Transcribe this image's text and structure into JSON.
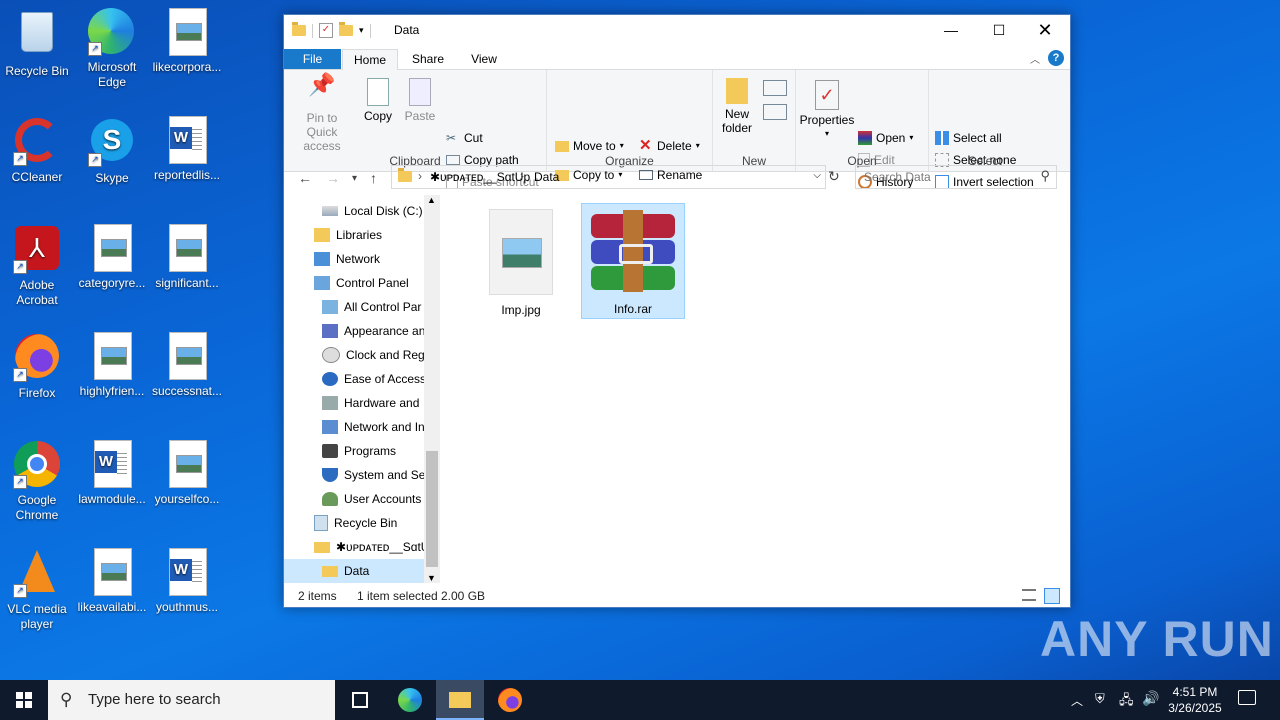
{
  "desktop": {
    "icons": [
      {
        "label": "Recycle Bin"
      },
      {
        "label": "Microsoft Edge"
      },
      {
        "label": "likecorpora..."
      },
      {
        "label": "CCleaner"
      },
      {
        "label": "Skype"
      },
      {
        "label": "reportedlis..."
      },
      {
        "label": "Adobe Acrobat"
      },
      {
        "label": "categoryre..."
      },
      {
        "label": "significant..."
      },
      {
        "label": "Firefox"
      },
      {
        "label": "highlyfrien..."
      },
      {
        "label": "successnat..."
      },
      {
        "label": "Google Chrome"
      },
      {
        "label": "lawmodule..."
      },
      {
        "label": "yourselfco..."
      },
      {
        "label": "VLC media player"
      },
      {
        "label": "likeavailabi..."
      },
      {
        "label": "youthmus..."
      }
    ]
  },
  "window": {
    "title": "Data",
    "tabs": [
      "File",
      "Home",
      "Share",
      "View"
    ],
    "ribbon": {
      "clipboard": {
        "label": "Clipboard",
        "pin": "Pin to Quick access",
        "copy": "Copy",
        "paste": "Paste",
        "cut": "Cut",
        "copy_path": "Copy path",
        "paste_shortcut": "Paste shortcut"
      },
      "organize": {
        "label": "Organize",
        "move_to": "Move to",
        "copy_to": "Copy to",
        "delete": "Delete",
        "rename": "Rename"
      },
      "new": {
        "label": "New",
        "new_folder": "New folder"
      },
      "open": {
        "label": "Open",
        "properties": "Properties",
        "open": "Open",
        "edit": "Edit",
        "history": "History"
      },
      "select": {
        "label": "Select",
        "select_all": "Select all",
        "select_none": "Select none",
        "invert": "Invert selection"
      }
    },
    "address": {
      "crumb1": "✱ᴜᴘᴅᴀᴛᴇᴅ__SɑtUp",
      "crumb2": "Data"
    },
    "search_placeholder": "Search Data",
    "tree": [
      "Local Disk (C:)",
      "Libraries",
      "Network",
      "Control Panel",
      "All Control Par",
      "Appearance an",
      "Clock and Regi",
      "Ease of Access",
      "Hardware and",
      "Network and In",
      "Programs",
      "System and Sec",
      "User Accounts",
      "Recycle Bin",
      "✱ᴜᴘᴅᴀᴛᴇᴅ__SɑtUp",
      "Data"
    ],
    "files": [
      {
        "name": "Imp.jpg"
      },
      {
        "name": "Info.rar"
      }
    ],
    "status": {
      "count": "2 items",
      "selected": "1 item selected",
      "size": "2.00 GB"
    }
  },
  "taskbar": {
    "search_placeholder": "Type here to search",
    "time": "4:51 PM",
    "date": "3/26/2025"
  },
  "watermark": "ANY RUN"
}
